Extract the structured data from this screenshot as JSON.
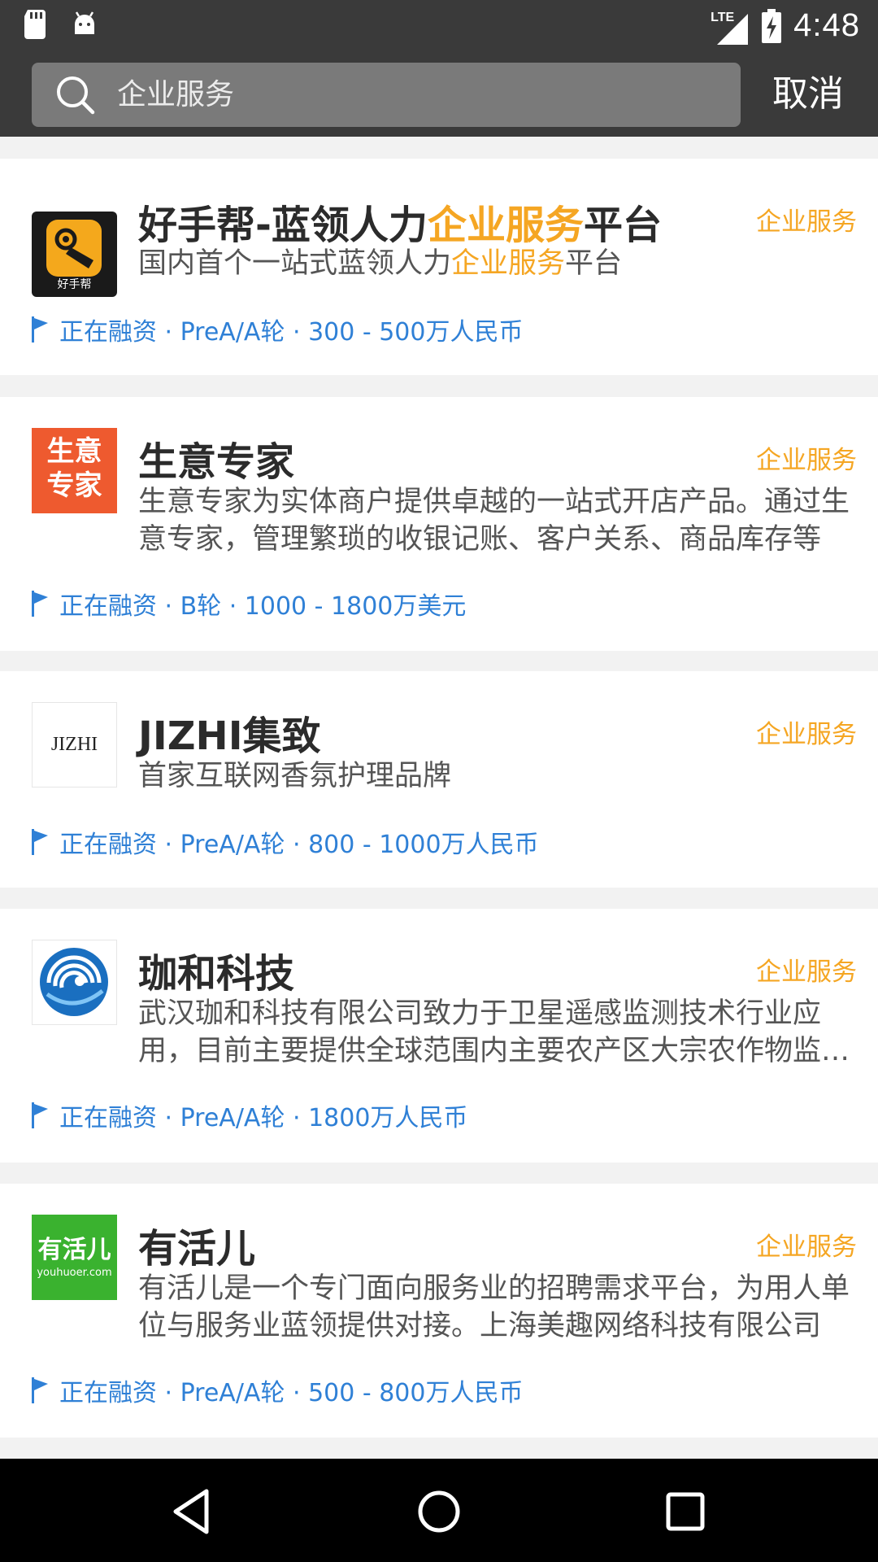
{
  "status_bar": {
    "network": "LTE",
    "time": "4:48"
  },
  "search": {
    "query": "企业服务",
    "cancel_label": "取消"
  },
  "colors": {
    "header_bg": "#3a3a3a",
    "highlight": "#f5a623",
    "funding": "#2f80d6"
  },
  "items": [
    {
      "title_pre": "好手帮-蓝领人力",
      "title_hl": "企业服务",
      "title_post": "平台",
      "tag": "企业服务",
      "desc_pre": "国内首个一站式蓝领人力",
      "desc_hl": "企业服务",
      "desc_post": "平台",
      "funding": "正在融资 · PreA/A轮 · 300 - 500万人民币",
      "logo_text": "好手帮"
    },
    {
      "title": "生意专家",
      "tag": "企业服务",
      "desc": "生意专家为实体商户提供卓越的一站式开店产品。通过生意专家，管理繁琐的收银记账、客户关系、商品库存等",
      "funding": "正在融资 · B轮 · 1000 - 1800万美元",
      "logo_line1": "生意",
      "logo_line2": "专家"
    },
    {
      "title": "JIZHI集致",
      "tag": "企业服务",
      "desc": "首家互联网香氛护理品牌",
      "funding": "正在融资 · PreA/A轮 · 800 - 1000万人民币",
      "logo_text": "JIZHI"
    },
    {
      "title": "珈和科技",
      "tag": "企业服务",
      "desc": "武汉珈和科技有限公司致力于卫星遥感监测技术行业应用，目前主要提供全球范围内主要农产区大宗农作物监测服务",
      "funding": "正在融资 · PreA/A轮 · 1800万人民币"
    },
    {
      "title": "有活儿",
      "tag": "企业服务",
      "desc": "有活儿是一个专门面向服务业的招聘需求平台，为用人单位与服务业蓝领提供对接。上海美趣网络科技有限公司",
      "funding": "正在融资 · PreA/A轮 · 500 - 800万人民币",
      "logo_line1": "有活儿",
      "logo_line2": "youhuoer.com"
    }
  ]
}
